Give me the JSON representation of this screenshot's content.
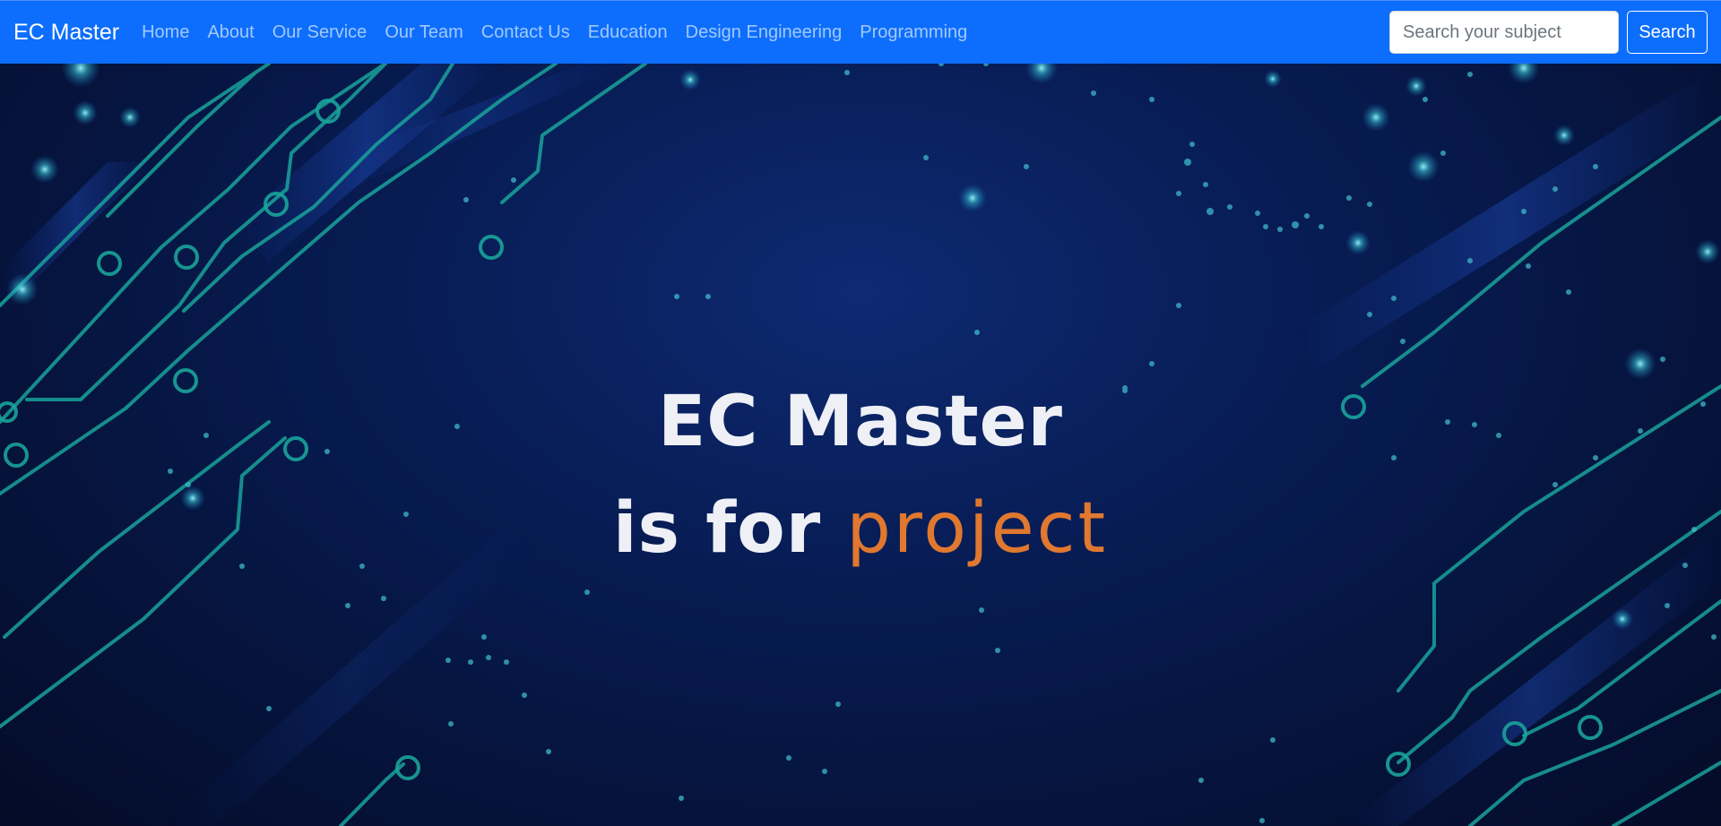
{
  "navbar": {
    "brand": "EC Master",
    "links": [
      "Home",
      "About",
      "Our Service",
      "Our Team",
      "Contact Us",
      "Education",
      "Design Engineering",
      "Programming"
    ],
    "search": {
      "placeholder": "Search your subject",
      "value": "",
      "button_label": "Search"
    }
  },
  "hero": {
    "title": "EC Master",
    "subtitle_prefix": "is for",
    "subtitle_accent": "project"
  },
  "colors": {
    "navbar": "#0d6efd",
    "hero_background": "#061540",
    "circuit_lines": "#1aa39a",
    "accent": "#e07830",
    "hero_text": "#eef0f6"
  },
  "icons": [
    "circuit-board-background"
  ]
}
